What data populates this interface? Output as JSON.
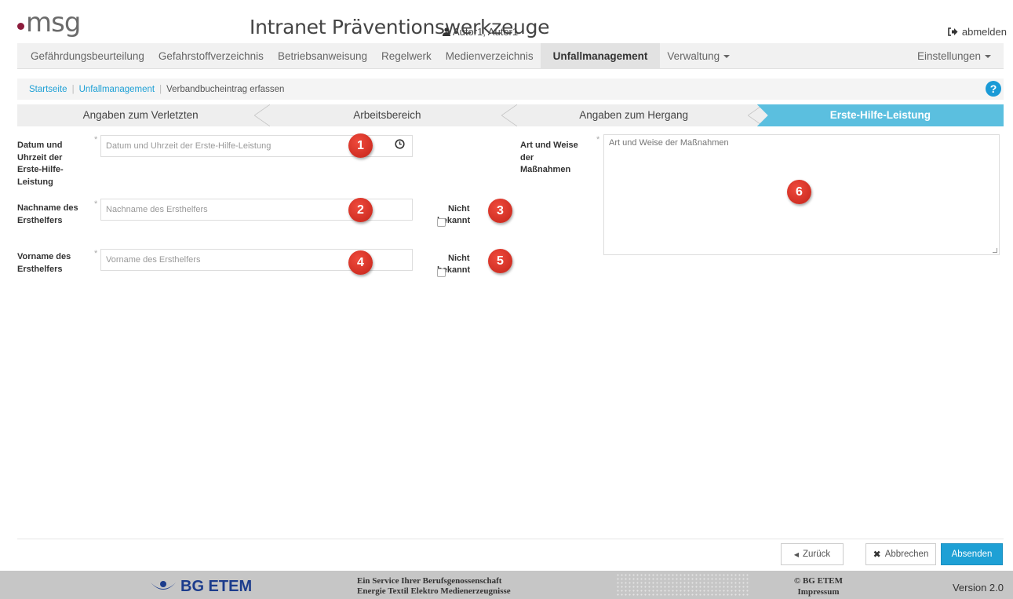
{
  "header": {
    "logo_text": "msg",
    "app_title": "Intranet Präventionswerkzeuge",
    "user": "Autor1, Autor1",
    "logout": "abmelden"
  },
  "nav": {
    "items": [
      "Gefährdungsbeurteilung",
      "Gefahrstoffverzeichnis",
      "Betriebsanweisung",
      "Regelwerk",
      "Medienverzeichnis",
      "Unfallmanagement",
      "Verwaltung",
      "Einstellungen"
    ],
    "active": "Unfallmanagement"
  },
  "breadcrumb": {
    "items": [
      "Startseite",
      "Unfallmanagement",
      "Verbandbucheintrag erfassen"
    ],
    "separator": "|"
  },
  "help_label": "?",
  "steps": [
    "Angaben zum Verletzten",
    "Arbeitsbereich",
    "Angaben zum Hergang",
    "Erste-Hilfe-Leistung"
  ],
  "form": {
    "required_mark": "*",
    "datum": {
      "label": "Datum und Uhrzeit der Erste-Hilfe-Leistung",
      "placeholder": "Datum und Uhrzeit der Erste-Hilfe-Leistung"
    },
    "nachname": {
      "label": "Nachname des Ersthelfers",
      "placeholder": "Nachname des Ersthelfers",
      "unknown_label": "Nicht bekannt"
    },
    "vorname": {
      "label": "Vorname des Ersthelfers",
      "placeholder": "Vorname des Ersthelfers",
      "unknown_label": "Nicht bekannt"
    },
    "massnahmen": {
      "label": "Art und Weise der Maßnahmen",
      "placeholder": "Art und Weise der Maßnahmen"
    }
  },
  "badges": [
    "1",
    "2",
    "3",
    "4",
    "5",
    "6"
  ],
  "buttons": {
    "back": "Zurück",
    "cancel": "Abbrechen",
    "submit": "Absenden"
  },
  "footer": {
    "logo": "BG ETEM",
    "service_line1": "Ein Service Ihrer Berufsgenossenschaft",
    "service_line2": "Energie Textil Elektro Medienerzeugnisse",
    "copyright": "© BG ETEM",
    "impressum": "Impressum",
    "version": "Version 2.0"
  },
  "colors": {
    "accent": "#1ea0d5",
    "active_step": "#5bbfdf",
    "badge": "#d42d20",
    "logo_dot": "#8c1c3c",
    "footer_bg": "#c6c6c6"
  }
}
